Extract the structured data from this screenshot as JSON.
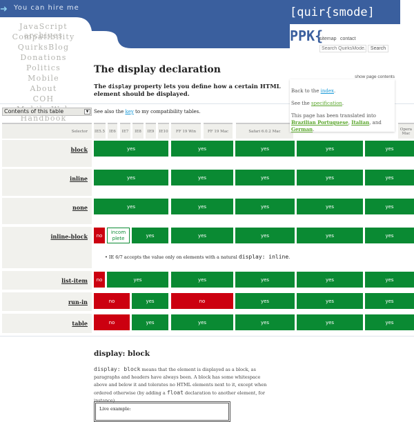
{
  "header": {
    "hire": "You can hire me",
    "logo": "[quir{smode]",
    "ppk": "PPK{",
    "sitemap": "sitemap",
    "contact": "contact",
    "search_placeholder": "Search QuirksMode.org",
    "search_button": "Search",
    "brand_color": "#3a5f9e"
  },
  "nav": [
    "JavaScript archives",
    "Compatibility",
    "QuirksBlog",
    "Donations",
    "Politics",
    "Mobile",
    "About",
    "COH",
    "Mobile Web Handbook"
  ],
  "page": {
    "title": "The display declaration",
    "intro_pre": "The ",
    "intro_code": "display",
    "intro_post": " property lets you define how a certain HTML element should be displayed.",
    "toc_select": "Contents of this table",
    "see_pre": "See also the ",
    "see_link": "key",
    "see_post": " to my compatibility tables."
  },
  "popup": {
    "show_contents": "show page contents",
    "back_pre": "Back to the ",
    "back_link": "index",
    "spec_pre": "See the ",
    "spec_link": "specification",
    "trans_pre": "This page has been translated into ",
    "trans_1": "Brazilian Portuguese",
    "trans_2": "Italian",
    "trans_and": ", and ",
    "trans_3": "German"
  },
  "table": {
    "headers": [
      "Selector",
      "IE5.5",
      "IE6",
      "IE7",
      "IE8",
      "IE9",
      "IE10",
      "FF 19 Win",
      "FF 19 Mac",
      "Safari 6.0.2 Mac",
      "Opera Mac"
    ],
    "rows": [
      {
        "selector": "block",
        "cells": [
          {
            "v": "yes",
            "span": 6
          },
          {
            "v": "yes",
            "span": 1
          },
          {
            "v": "yes",
            "span": 1
          },
          {
            "v": "yes",
            "span": 1
          },
          {
            "v": "yes",
            "span": 1
          }
        ]
      },
      {
        "selector": "inline",
        "cells": [
          {
            "v": "yes",
            "span": 6
          },
          {
            "v": "yes",
            "span": 1
          },
          {
            "v": "yes",
            "span": 1
          },
          {
            "v": "yes",
            "span": 1
          },
          {
            "v": "yes",
            "span": 1
          }
        ]
      },
      {
        "selector": "none",
        "cells": [
          {
            "v": "yes",
            "span": 6
          },
          {
            "v": "yes",
            "span": 1
          },
          {
            "v": "yes",
            "span": 1
          },
          {
            "v": "yes",
            "span": 1
          },
          {
            "v": "yes",
            "span": 1
          }
        ]
      },
      {
        "selector": "inline-block",
        "cells": [
          {
            "v": "no",
            "span": 1
          },
          {
            "v": "incomplete",
            "label": "incom plete",
            "span": 2
          },
          {
            "v": "yes",
            "span": 3
          },
          {
            "v": "yes",
            "span": 1
          },
          {
            "v": "yes",
            "span": 1
          },
          {
            "v": "yes",
            "span": 1
          },
          {
            "v": "yes",
            "span": 1
          }
        ],
        "note_pre": "IE 6/7 accepts the value only on elements with a natural ",
        "note_code": "display: inline",
        "note_post": "."
      },
      {
        "selector": "list-item",
        "cells": [
          {
            "v": "no",
            "span": 1
          },
          {
            "v": "yes",
            "span": 5
          },
          {
            "v": "yes",
            "span": 1
          },
          {
            "v": "yes",
            "span": 1
          },
          {
            "v": "yes",
            "span": 1
          },
          {
            "v": "yes",
            "span": 1
          }
        ]
      },
      {
        "selector": "run-in",
        "cells": [
          {
            "v": "no",
            "span": 3
          },
          {
            "v": "yes",
            "span": 3
          },
          {
            "v": "no",
            "span": 1
          },
          {
            "v": "yes",
            "span": 1
          },
          {
            "v": "yes",
            "span": 1
          },
          {
            "v": "yes",
            "span": 1
          }
        ]
      },
      {
        "selector": "table",
        "cells": [
          {
            "v": "no",
            "span": 3
          },
          {
            "v": "yes",
            "span": 3
          },
          {
            "v": "yes",
            "span": 1
          },
          {
            "v": "yes",
            "span": 1
          },
          {
            "v": "yes",
            "span": 1
          },
          {
            "v": "yes",
            "span": 1
          }
        ]
      }
    ]
  },
  "section": {
    "title": "display: block",
    "code1": "display: block",
    "text1": " means that the element is displayed as a block, as paragraphs and headers have always been. A block has some whitespace above and below it and tolerates no HTML elements next to it, except when ordered otherwise (by adding a ",
    "code2": "float",
    "text2": " declaration to another element, for instance).",
    "live": "Live example:"
  },
  "colors": {
    "yes": "#0a8a33",
    "no": "#cc0010"
  }
}
